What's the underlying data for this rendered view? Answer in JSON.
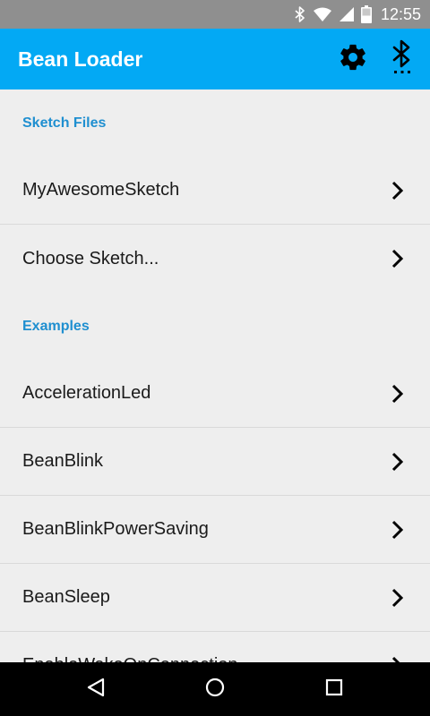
{
  "status_bar": {
    "time": "12:55",
    "icons": [
      "bluetooth-icon",
      "wifi-icon",
      "signal-icon",
      "battery-icon"
    ]
  },
  "app_bar": {
    "title": "Bean Loader",
    "actions": [
      "settings-icon",
      "bluetooth-searching-icon"
    ],
    "background_color": "#03a9f4"
  },
  "sections": {
    "sketch_files": {
      "header": "Sketch Files",
      "items": [
        "MyAwesomeSketch",
        "Choose Sketch..."
      ]
    },
    "examples": {
      "header": "Examples",
      "items": [
        "AccelerationLed",
        "BeanBlink",
        "BeanBlinkPowerSaving",
        "BeanSleep",
        "EnableWakeOnConnection"
      ]
    }
  },
  "nav_bar": {
    "buttons": [
      "back-icon",
      "home-icon",
      "recents-icon"
    ]
  },
  "colors": {
    "accent": "#1f8fd0",
    "status_bar": "#8f8f8f",
    "background": "#eeeeee"
  }
}
